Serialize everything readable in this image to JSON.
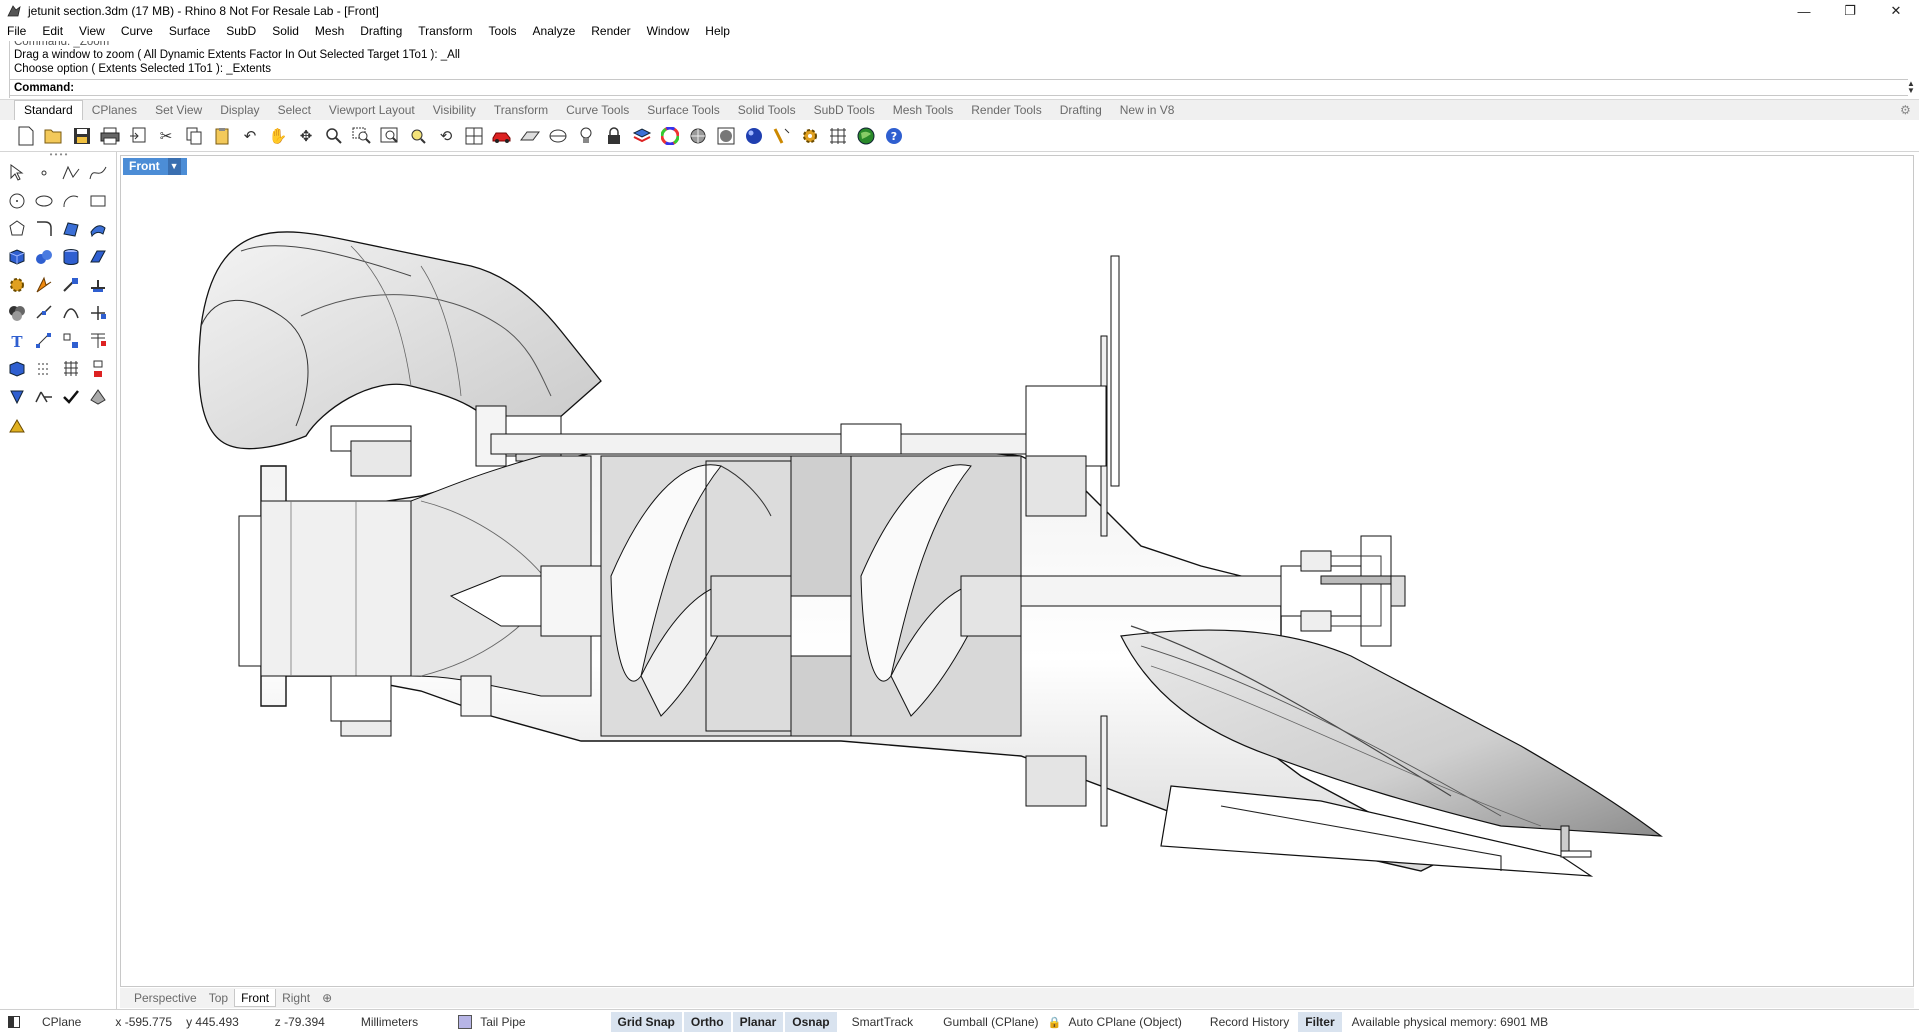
{
  "window": {
    "title": "jetunit section.3dm (17 MB) - Rhino 8 Not For Resale Lab - [Front]",
    "controls": [
      "—",
      "❐",
      "✕"
    ]
  },
  "menu": [
    "File",
    "Edit",
    "View",
    "Curve",
    "Surface",
    "SubD",
    "Solid",
    "Mesh",
    "Drafting",
    "Transform",
    "Tools",
    "Analyze",
    "Render",
    "Window",
    "Help"
  ],
  "command": {
    "history_top": "Command: _Zoom",
    "line1": "Drag a window to zoom ( All  Dynamic  Extents  Factor  In  Out  Selected  Target  1To1 ): _All",
    "line2": "Choose option ( Extents  Selected  1To1 ): _Extents",
    "prompt": "Command:"
  },
  "toolbar_tabs": [
    "Standard",
    "CPlanes",
    "Set View",
    "Display",
    "Select",
    "Viewport Layout",
    "Visibility",
    "Transform",
    "Curve Tools",
    "Surface Tools",
    "Solid Tools",
    "SubD Tools",
    "Mesh Tools",
    "Render Tools",
    "Drafting",
    "New in V8"
  ],
  "toolbar_icons": [
    "new-icon",
    "open-icon",
    "save-icon",
    "print-icon",
    "import-icon",
    "cut-icon",
    "copy-icon",
    "paste-icon",
    "undo-icon",
    "pan-icon",
    "rotate-view-icon",
    "zoom-icon",
    "zoom-window-icon",
    "zoom-extents-icon",
    "zoom-selected-icon",
    "rotate-icon",
    "four-viewports-icon",
    "car-icon",
    "cplane-icon",
    "dimension-icon",
    "light-icon",
    "lock-icon",
    "layer-icon",
    "color-wheel-icon",
    "shaded-sphere-icon",
    "render-sphere-icon",
    "blue-sphere-icon",
    "wand-icon",
    "gear-icon",
    "grid-icon",
    "globe-icon",
    "help-icon"
  ],
  "viewport": {
    "label": "Front",
    "tabs": [
      "Perspective",
      "Top",
      "Front",
      "Right"
    ],
    "active_tab": "Front",
    "add": "⊕"
  },
  "status": {
    "cplane": "CPlane",
    "x": "x -595.775",
    "y": "y 445.493",
    "z": "z -79.394",
    "units": "Millimeters",
    "layer": "Tail Pipe",
    "layer_color": "#b7b5e6",
    "grid_snap": "Grid Snap",
    "ortho": "Ortho",
    "planar": "Planar",
    "osnap": "Osnap",
    "smarttrack": "SmartTrack",
    "gumball": "Gumball (CPlane)",
    "auto_cplane": "Auto CPlane (Object)",
    "record_history": "Record History",
    "filter": "Filter",
    "memory": "Available physical memory: 6901 MB"
  }
}
